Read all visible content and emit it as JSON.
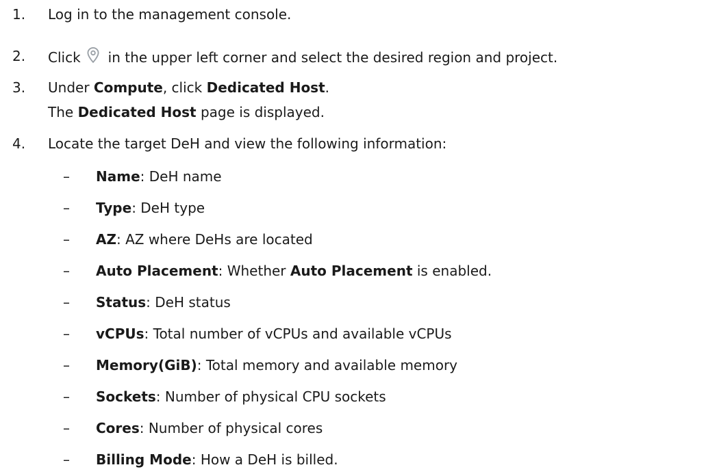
{
  "steps": [
    {
      "num": "1.",
      "text": "Log in to the management console."
    },
    {
      "num": "2.",
      "pre": "Click",
      "icon": "location-pin-icon",
      "post": "in the upper left corner and select the desired region and project."
    },
    {
      "num": "3.",
      "pre": "Under ",
      "b1": "Compute",
      "mid": ", click ",
      "b2": "Dedicated Host",
      "post": "."
    },
    {
      "sub_pre": "The ",
      "sub_b": "Dedicated Host",
      "sub_post": " page is displayed."
    },
    {
      "num": "4.",
      "text": "Locate the target DeH and view the following information:"
    }
  ],
  "fields": [
    {
      "dash": "–",
      "name": "Name",
      "desc": ": DeH name"
    },
    {
      "dash": "–",
      "name": "Type",
      "desc": ": DeH type"
    },
    {
      "dash": "–",
      "name": "AZ",
      "desc": ": AZ where DeHs are located"
    },
    {
      "dash": "–",
      "name": "Auto Placement",
      "desc": ": Whether ",
      "name2": "Auto Placement",
      "desc2": " is enabled."
    },
    {
      "dash": "–",
      "name": "Status",
      "desc": ": DeH status"
    },
    {
      "dash": "–",
      "name": "vCPUs",
      "desc": ": Total number of vCPUs and available vCPUs"
    },
    {
      "dash": "–",
      "name": "Memory(GiB)",
      "desc": ": Total memory and available memory"
    },
    {
      "dash": "–",
      "name": "Sockets",
      "desc": ": Number of physical CPU sockets"
    },
    {
      "dash": "–",
      "name": "Cores",
      "desc": ": Number of physical cores"
    },
    {
      "dash": "–",
      "name": "Billing Mode",
      "desc": ": How a DeH is billed."
    }
  ],
  "colors": {
    "text": "#1a1a1a",
    "icon": "#9aa0a6"
  }
}
